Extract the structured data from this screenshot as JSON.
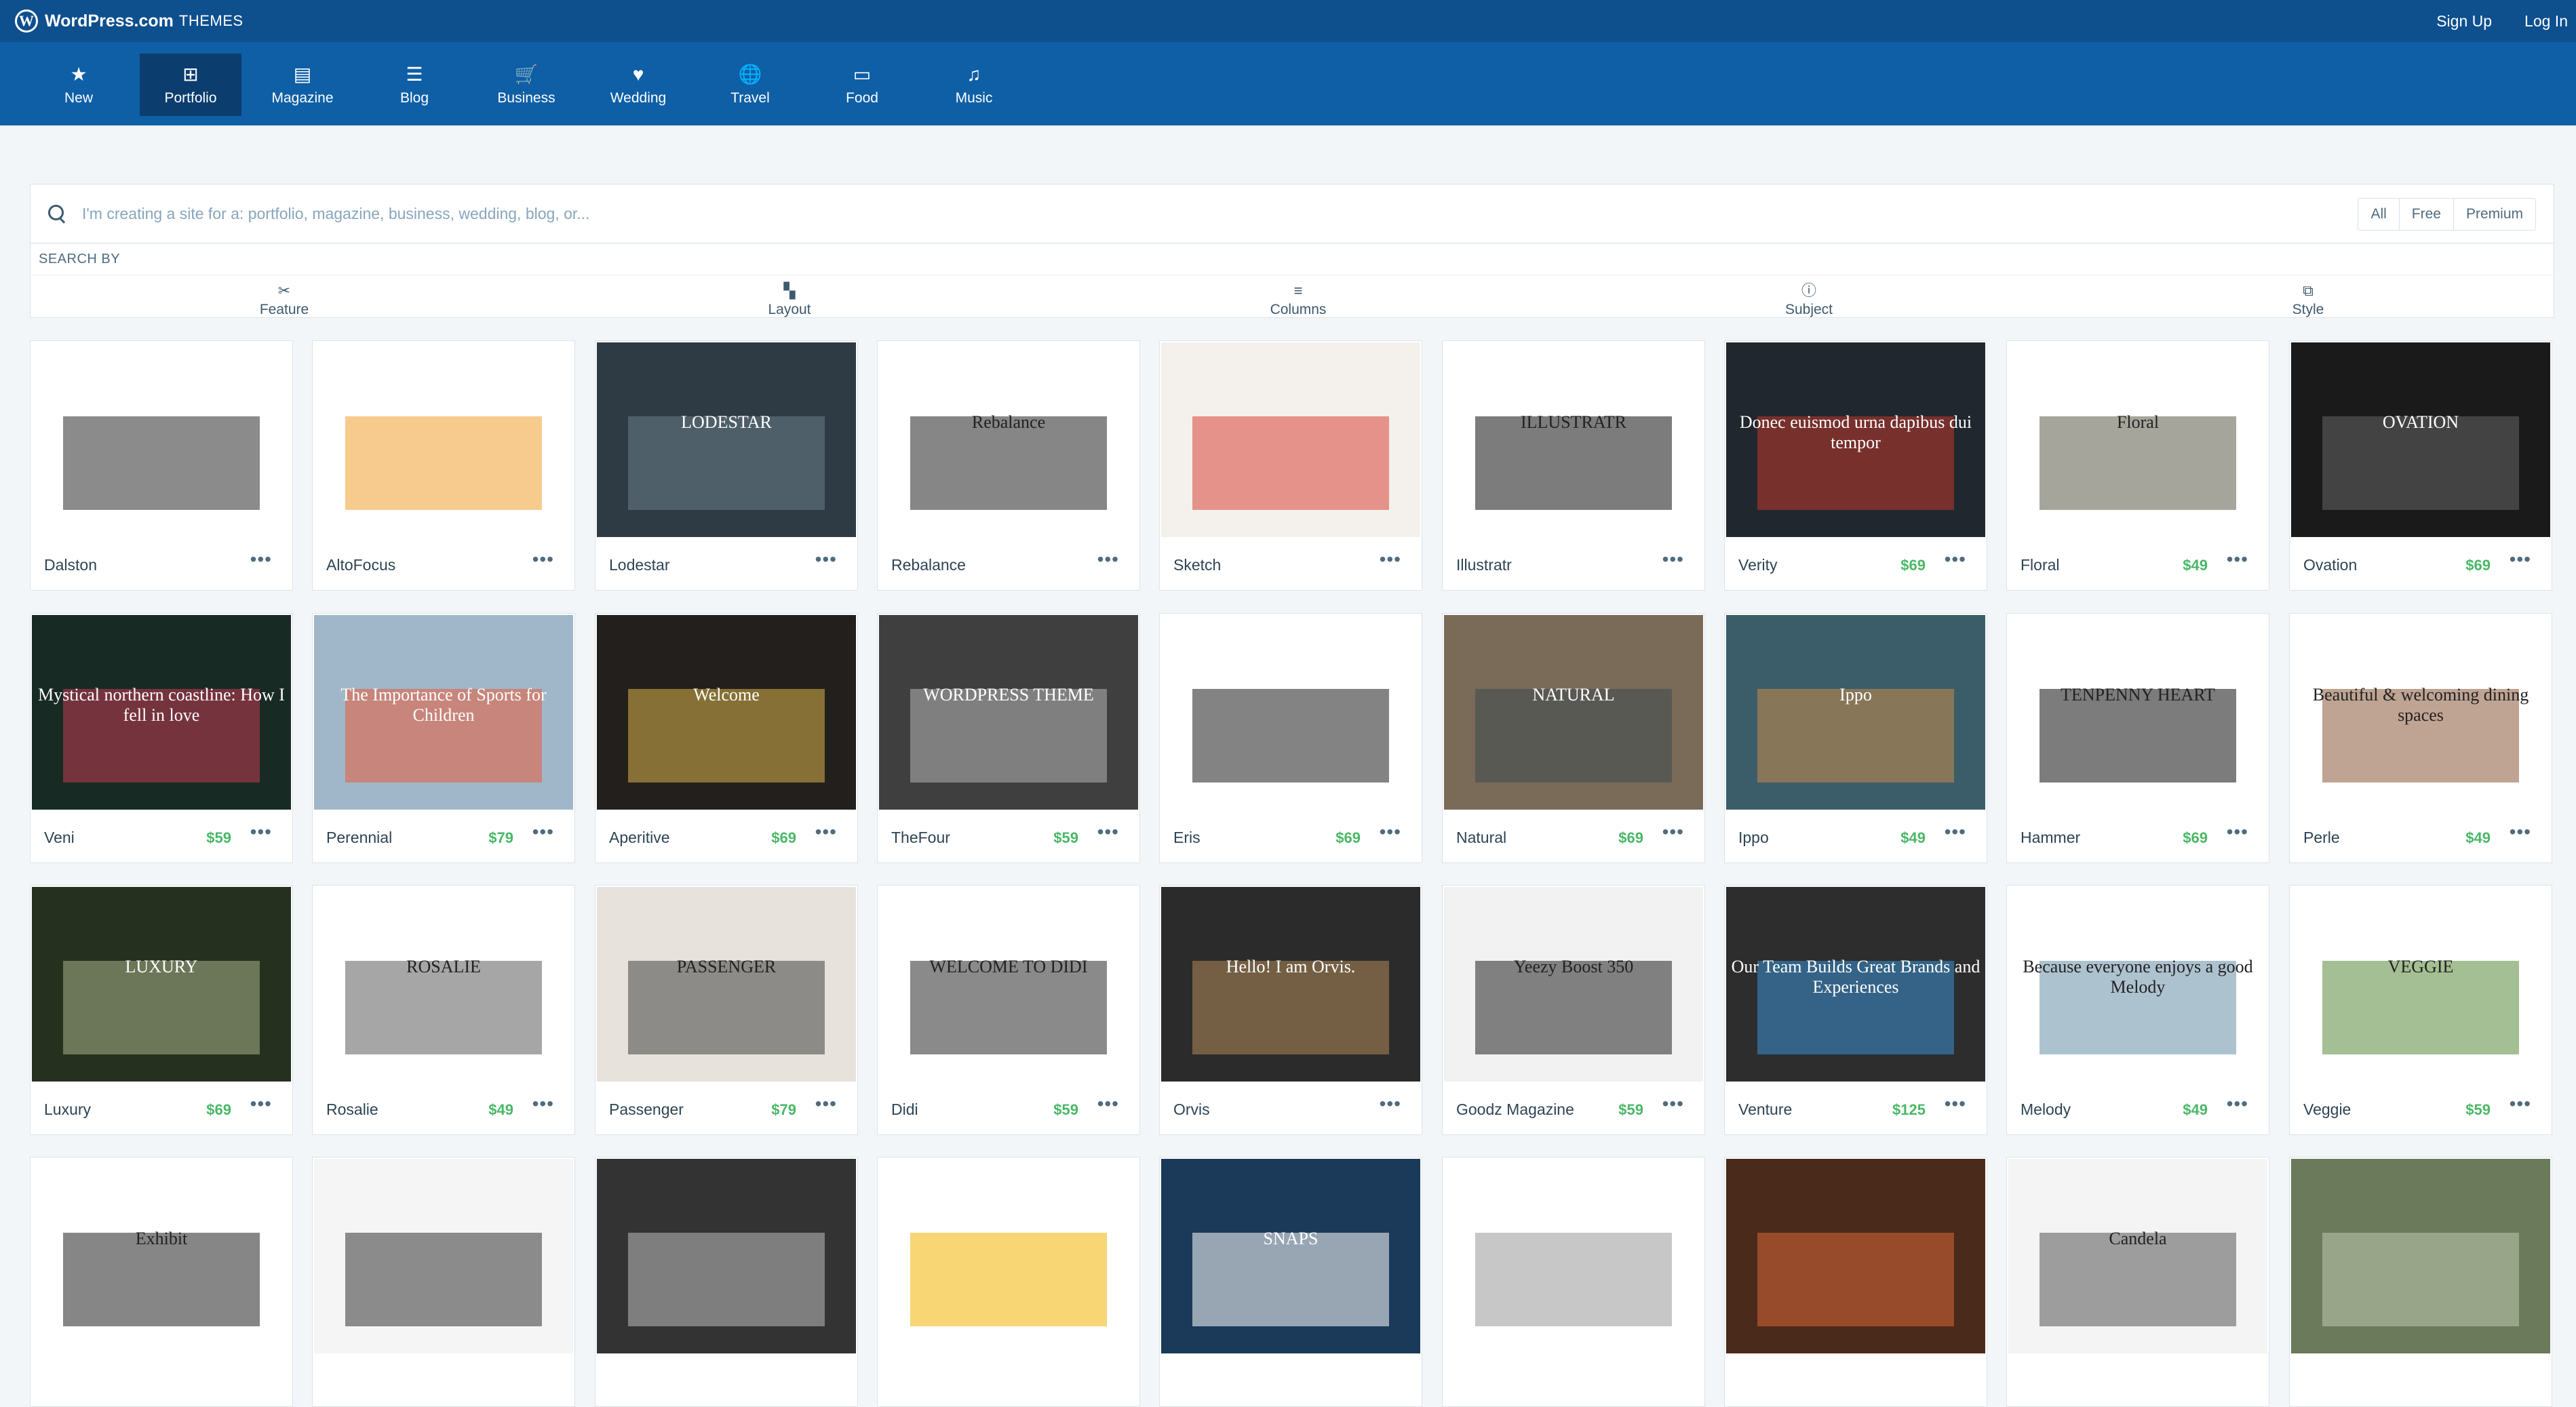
{
  "masterbar": {
    "brand_name": "WordPress.com",
    "brand_sub": "THEMES",
    "signup": "Sign Up",
    "login": "Log In"
  },
  "categories": [
    {
      "label": "New",
      "icon": "★"
    },
    {
      "label": "Portfolio",
      "icon": "⊞",
      "active": true
    },
    {
      "label": "Magazine",
      "icon": "▤"
    },
    {
      "label": "Blog",
      "icon": "☰"
    },
    {
      "label": "Business",
      "icon": "🛒"
    },
    {
      "label": "Wedding",
      "icon": "♥"
    },
    {
      "label": "Travel",
      "icon": "🌐"
    },
    {
      "label": "Food",
      "icon": "▭"
    },
    {
      "label": "Music",
      "icon": "♫"
    }
  ],
  "search": {
    "placeholder": "I'm creating a site for a: portfolio, magazine, business, wedding, blog, or...",
    "filters": [
      "All",
      "Free",
      "Premium"
    ]
  },
  "search_by": {
    "title": "SEARCH BY",
    "items": [
      {
        "label": "Feature",
        "icon": "✂"
      },
      {
        "label": "Layout",
        "icon": "▚"
      },
      {
        "label": "Columns",
        "icon": "≡"
      },
      {
        "label": "Subject",
        "icon": "ⓘ"
      },
      {
        "label": "Style",
        "icon": "⧉"
      }
    ]
  },
  "themes": [
    {
      "name": "Dalston",
      "price": "",
      "more": "•••",
      "bg": "#ffffff",
      "accent": "#2b2b2b",
      "caption": ""
    },
    {
      "name": "AltoFocus",
      "price": "",
      "more": "•••",
      "bg": "#ffffff",
      "accent": "#f0a030",
      "caption": ""
    },
    {
      "name": "Lodestar",
      "price": "",
      "more": "•••",
      "bg": "#2e3a44",
      "accent": "#6b7d8a",
      "caption": "LODESTAR"
    },
    {
      "name": "Rebalance",
      "price": "",
      "more": "•••",
      "bg": "#ffffff",
      "accent": "#222222",
      "caption": "Rebalance"
    },
    {
      "name": "Sketch",
      "price": "",
      "more": "•••",
      "bg": "#f4f1ec",
      "accent": "#d9443a",
      "caption": ""
    },
    {
      "name": "Illustratr",
      "price": "",
      "more": "•••",
      "bg": "#ffffff",
      "accent": "#111111",
      "caption": "ILLUSTRATR"
    },
    {
      "name": "Verity",
      "price": "$69",
      "more": "•••",
      "bg": "#20272e",
      "accent": "#c0392b",
      "caption": "Donec euismod urna dapibus dui tempor"
    },
    {
      "name": "Floral",
      "price": "$49",
      "more": "•••",
      "bg": "#ffffff",
      "accent": "#5b5b4a",
      "caption": "Floral"
    },
    {
      "name": "Ovation",
      "price": "$69",
      "more": "•••",
      "bg": "#1a1a1a",
      "accent": "#666666",
      "caption": "OVATION"
    },
    {
      "name": "Veni",
      "price": "$59",
      "more": "•••",
      "bg": "#182a24",
      "accent": "#c23b54",
      "caption": "Mystical northern coastline: How I fell in love"
    },
    {
      "name": "Perennial",
      "price": "$79",
      "more": "•••",
      "bg": "#9fb7c9",
      "accent": "#e85d3a",
      "caption": "The Importance of Sports for Children"
    },
    {
      "name": "Aperitive",
      "price": "$69",
      "more": "•••",
      "bg": "#221f1c",
      "accent": "#d8b24a",
      "caption": "Welcome"
    },
    {
      "name": "TheFour",
      "price": "$59",
      "more": "•••",
      "bg": "#3f3f3f",
      "accent": "#b5b5b5",
      "caption": "WORDPRESS THEME"
    },
    {
      "name": "Eris",
      "price": "$69",
      "more": "•••",
      "bg": "#ffffff",
      "accent": "#1e1e1e",
      "caption": ""
    },
    {
      "name": "Natural",
      "price": "$69",
      "more": "•••",
      "bg": "#7a6a58",
      "accent": "#3e4a52",
      "caption": "NATURAL"
    },
    {
      "name": "Ippo",
      "price": "$49",
      "more": "•••",
      "bg": "#3b5d6a",
      "accent": "#c98a4a",
      "caption": "Ippo"
    },
    {
      "name": "Hammer",
      "price": "$69",
      "more": "•••",
      "bg": "#ffffff",
      "accent": "#111111",
      "caption": "TENPENNY HEART"
    },
    {
      "name": "Perle",
      "price": "$49",
      "more": "•••",
      "bg": "#ffffff",
      "accent": "#8a5a3a",
      "caption": "Beautiful & welcoming dining spaces"
    },
    {
      "name": "Luxury",
      "price": "$69",
      "more": "•••",
      "bg": "#25301e",
      "accent": "#a8b089",
      "caption": "LUXURY"
    },
    {
      "name": "Rosalie",
      "price": "$49",
      "more": "•••",
      "bg": "#ffffff",
      "accent": "#5c5c5c",
      "caption": "ROSALIE"
    },
    {
      "name": "Passenger",
      "price": "$79",
      "more": "•••",
      "bg": "#e7e3dc",
      "accent": "#444444",
      "caption": "PASSENGER"
    },
    {
      "name": "Didi",
      "price": "$59",
      "more": "•••",
      "bg": "#ffffff",
      "accent": "#2a2a2a",
      "caption": "WELCOME TO DIDI"
    },
    {
      "name": "Orvis",
      "price": "",
      "more": "•••",
      "bg": "#2b2b2b",
      "accent": "#b08a5a",
      "caption": "Hello! I am Orvis."
    },
    {
      "name": "Goodz Magazine",
      "price": "$59",
      "more": "•••",
      "bg": "#f2f2f2",
      "accent": "#222222",
      "caption": "Yeezy Boost 350"
    },
    {
      "name": "Venture",
      "price": "$125",
      "more": "•••",
      "bg": "#2d2d2d",
      "accent": "#3a8fd1",
      "caption": "Our Team Builds Great Brands and Experiences"
    },
    {
      "name": "Melody",
      "price": "$49",
      "more": "•••",
      "bg": "#ffffff",
      "accent": "#6a8fa8",
      "caption": "Because everyone enjoys a good Melody"
    },
    {
      "name": "Veggie",
      "price": "$59",
      "more": "•••",
      "bg": "#ffffff",
      "accent": "#5a8a3a",
      "caption": "VEGGIE"
    },
    {
      "name": "",
      "price": "",
      "more": "",
      "bg": "#ffffff",
      "accent": "#222222",
      "caption": "Exhibit"
    },
    {
      "name": "",
      "price": "",
      "more": "",
      "bg": "#f5f5f5",
      "accent": "#333333",
      "caption": ""
    },
    {
      "name": "",
      "price": "",
      "more": "",
      "bg": "#333333",
      "accent": "#bbbbbb",
      "caption": ""
    },
    {
      "name": "",
      "price": "",
      "more": "",
      "bg": "#ffffff",
      "accent": "#f0b400",
      "caption": ""
    },
    {
      "name": "",
      "price": "",
      "more": "",
      "bg": "#1b3a5a",
      "accent": "#ffffff",
      "caption": "SNAPS"
    },
    {
      "name": "",
      "price": "",
      "more": "",
      "bg": "#ffffff",
      "accent": "#999999",
      "caption": ""
    },
    {
      "name": "",
      "price": "",
      "more": "",
      "bg": "#4a2a1a",
      "accent": "#d8663a",
      "caption": ""
    },
    {
      "name": "",
      "price": "",
      "more": "",
      "bg": "#f4f4f4",
      "accent": "#555555",
      "caption": "Candela"
    },
    {
      "name": "",
      "price": "",
      "more": "",
      "bg": "#6a7a5a",
      "accent": "#c0c8b0",
      "caption": ""
    }
  ]
}
